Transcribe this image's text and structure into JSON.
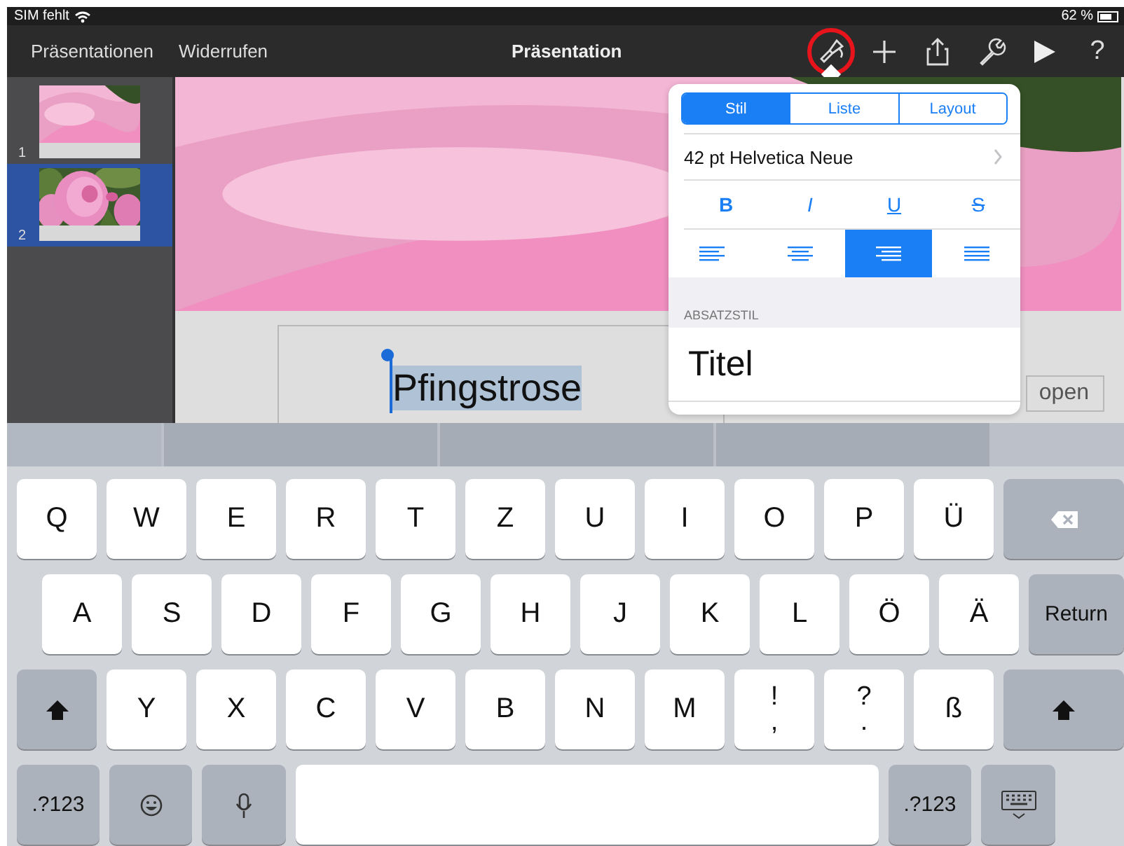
{
  "status_bar": {
    "carrier": "SIM fehlt",
    "battery": "62 %"
  },
  "toolbar": {
    "left": [
      "Präsentationen",
      "Widerrufen"
    ],
    "title": "Präsentation",
    "tools": [
      {
        "kind": "brush",
        "highlighted": true
      },
      {
        "kind": "plus",
        "highlighted": false
      },
      {
        "kind": "share",
        "highlighted": false
      },
      {
        "kind": "wrench",
        "highlighted": false
      },
      {
        "kind": "play",
        "highlighted": false
      },
      {
        "kind": "help",
        "label": "?",
        "highlighted": false
      }
    ]
  },
  "slides": [
    {
      "number": "1",
      "selected": false
    },
    {
      "number": "2",
      "selected": true
    }
  ],
  "slide": {
    "title": "Pfingstrose",
    "title_selected": true,
    "side_text": "open"
  },
  "popover": {
    "tabs": [
      {
        "label": "Stil",
        "selected": true
      },
      {
        "label": "Liste",
        "selected": false
      },
      {
        "label": "Layout",
        "selected": false
      }
    ],
    "font": "42 pt Helvetica Neue",
    "styles": [
      {
        "kind": "bold",
        "label": "B"
      },
      {
        "kind": "italic",
        "label": "I"
      },
      {
        "kind": "underline",
        "label": "U"
      },
      {
        "kind": "strike",
        "label": "S"
      }
    ],
    "alignments": [
      {
        "kind": "left",
        "selected": false
      },
      {
        "kind": "center",
        "selected": false
      },
      {
        "kind": "right",
        "selected": true
      },
      {
        "kind": "justify",
        "selected": false
      }
    ],
    "section": "ABSATZSTIL",
    "paragraph_style": "Titel"
  },
  "keyboard": {
    "rows": [
      [
        {
          "kind": "char",
          "label": "Q"
        },
        {
          "kind": "char",
          "label": "W"
        },
        {
          "kind": "char",
          "label": "E"
        },
        {
          "kind": "char",
          "label": "R"
        },
        {
          "kind": "char",
          "label": "T"
        },
        {
          "kind": "char",
          "label": "Z"
        },
        {
          "kind": "char",
          "label": "U"
        },
        {
          "kind": "char",
          "label": "I"
        },
        {
          "kind": "char",
          "label": "O"
        },
        {
          "kind": "char",
          "label": "P"
        },
        {
          "kind": "char",
          "label": "Ü"
        },
        {
          "kind": "backspace"
        }
      ],
      [
        {
          "kind": "char",
          "label": "A"
        },
        {
          "kind": "char",
          "label": "S"
        },
        {
          "kind": "char",
          "label": "D"
        },
        {
          "kind": "char",
          "label": "F"
        },
        {
          "kind": "char",
          "label": "G"
        },
        {
          "kind": "char",
          "label": "H"
        },
        {
          "kind": "char",
          "label": "J"
        },
        {
          "kind": "char",
          "label": "K"
        },
        {
          "kind": "char",
          "label": "L"
        },
        {
          "kind": "char",
          "label": "Ö"
        },
        {
          "kind": "char",
          "label": "Ä"
        },
        {
          "kind": "return",
          "label": "Return"
        }
      ],
      [
        {
          "kind": "shift"
        },
        {
          "kind": "char",
          "label": "Y"
        },
        {
          "kind": "char",
          "label": "X"
        },
        {
          "kind": "char",
          "label": "C"
        },
        {
          "kind": "char",
          "label": "V"
        },
        {
          "kind": "char",
          "label": "B"
        },
        {
          "kind": "char",
          "label": "N"
        },
        {
          "kind": "char",
          "label": "M"
        },
        {
          "kind": "dual",
          "label": "!",
          "sub": ","
        },
        {
          "kind": "dual",
          "label": "?",
          "sub": "."
        },
        {
          "kind": "char",
          "label": "ß"
        },
        {
          "kind": "shift"
        }
      ],
      [
        {
          "kind": "mode",
          "label": ".?123"
        },
        {
          "kind": "emoji"
        },
        {
          "kind": "mic"
        },
        {
          "kind": "space"
        },
        {
          "kind": "mode",
          "label": ".?123"
        },
        {
          "kind": "hide"
        }
      ]
    ]
  }
}
